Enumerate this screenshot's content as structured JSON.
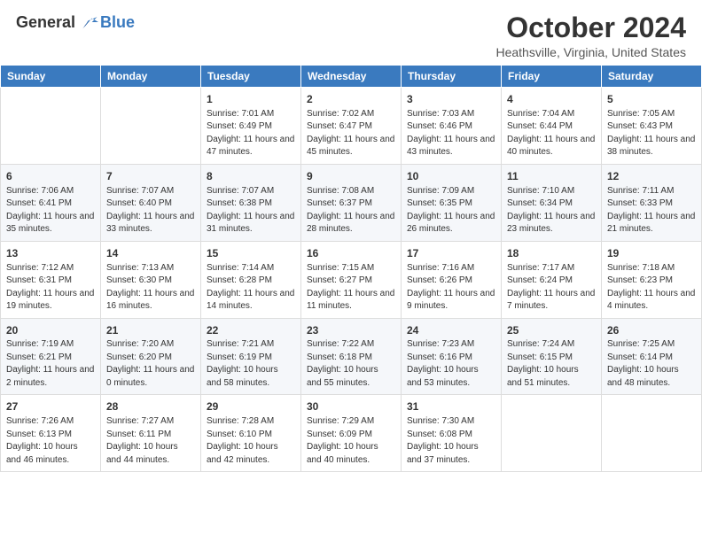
{
  "header": {
    "logo_general": "General",
    "logo_blue": "Blue",
    "title": "October 2024",
    "location": "Heathsville, Virginia, United States"
  },
  "days_of_week": [
    "Sunday",
    "Monday",
    "Tuesday",
    "Wednesday",
    "Thursday",
    "Friday",
    "Saturday"
  ],
  "weeks": [
    [
      {
        "day": "",
        "sunrise": "",
        "sunset": "",
        "daylight": ""
      },
      {
        "day": "",
        "sunrise": "",
        "sunset": "",
        "daylight": ""
      },
      {
        "day": "1",
        "sunrise": "Sunrise: 7:01 AM",
        "sunset": "Sunset: 6:49 PM",
        "daylight": "Daylight: 11 hours and 47 minutes."
      },
      {
        "day": "2",
        "sunrise": "Sunrise: 7:02 AM",
        "sunset": "Sunset: 6:47 PM",
        "daylight": "Daylight: 11 hours and 45 minutes."
      },
      {
        "day": "3",
        "sunrise": "Sunrise: 7:03 AM",
        "sunset": "Sunset: 6:46 PM",
        "daylight": "Daylight: 11 hours and 43 minutes."
      },
      {
        "day": "4",
        "sunrise": "Sunrise: 7:04 AM",
        "sunset": "Sunset: 6:44 PM",
        "daylight": "Daylight: 11 hours and 40 minutes."
      },
      {
        "day": "5",
        "sunrise": "Sunrise: 7:05 AM",
        "sunset": "Sunset: 6:43 PM",
        "daylight": "Daylight: 11 hours and 38 minutes."
      }
    ],
    [
      {
        "day": "6",
        "sunrise": "Sunrise: 7:06 AM",
        "sunset": "Sunset: 6:41 PM",
        "daylight": "Daylight: 11 hours and 35 minutes."
      },
      {
        "day": "7",
        "sunrise": "Sunrise: 7:07 AM",
        "sunset": "Sunset: 6:40 PM",
        "daylight": "Daylight: 11 hours and 33 minutes."
      },
      {
        "day": "8",
        "sunrise": "Sunrise: 7:07 AM",
        "sunset": "Sunset: 6:38 PM",
        "daylight": "Daylight: 11 hours and 31 minutes."
      },
      {
        "day": "9",
        "sunrise": "Sunrise: 7:08 AM",
        "sunset": "Sunset: 6:37 PM",
        "daylight": "Daylight: 11 hours and 28 minutes."
      },
      {
        "day": "10",
        "sunrise": "Sunrise: 7:09 AM",
        "sunset": "Sunset: 6:35 PM",
        "daylight": "Daylight: 11 hours and 26 minutes."
      },
      {
        "day": "11",
        "sunrise": "Sunrise: 7:10 AM",
        "sunset": "Sunset: 6:34 PM",
        "daylight": "Daylight: 11 hours and 23 minutes."
      },
      {
        "day": "12",
        "sunrise": "Sunrise: 7:11 AM",
        "sunset": "Sunset: 6:33 PM",
        "daylight": "Daylight: 11 hours and 21 minutes."
      }
    ],
    [
      {
        "day": "13",
        "sunrise": "Sunrise: 7:12 AM",
        "sunset": "Sunset: 6:31 PM",
        "daylight": "Daylight: 11 hours and 19 minutes."
      },
      {
        "day": "14",
        "sunrise": "Sunrise: 7:13 AM",
        "sunset": "Sunset: 6:30 PM",
        "daylight": "Daylight: 11 hours and 16 minutes."
      },
      {
        "day": "15",
        "sunrise": "Sunrise: 7:14 AM",
        "sunset": "Sunset: 6:28 PM",
        "daylight": "Daylight: 11 hours and 14 minutes."
      },
      {
        "day": "16",
        "sunrise": "Sunrise: 7:15 AM",
        "sunset": "Sunset: 6:27 PM",
        "daylight": "Daylight: 11 hours and 11 minutes."
      },
      {
        "day": "17",
        "sunrise": "Sunrise: 7:16 AM",
        "sunset": "Sunset: 6:26 PM",
        "daylight": "Daylight: 11 hours and 9 minutes."
      },
      {
        "day": "18",
        "sunrise": "Sunrise: 7:17 AM",
        "sunset": "Sunset: 6:24 PM",
        "daylight": "Daylight: 11 hours and 7 minutes."
      },
      {
        "day": "19",
        "sunrise": "Sunrise: 7:18 AM",
        "sunset": "Sunset: 6:23 PM",
        "daylight": "Daylight: 11 hours and 4 minutes."
      }
    ],
    [
      {
        "day": "20",
        "sunrise": "Sunrise: 7:19 AM",
        "sunset": "Sunset: 6:21 PM",
        "daylight": "Daylight: 11 hours and 2 minutes."
      },
      {
        "day": "21",
        "sunrise": "Sunrise: 7:20 AM",
        "sunset": "Sunset: 6:20 PM",
        "daylight": "Daylight: 11 hours and 0 minutes."
      },
      {
        "day": "22",
        "sunrise": "Sunrise: 7:21 AM",
        "sunset": "Sunset: 6:19 PM",
        "daylight": "Daylight: 10 hours and 58 minutes."
      },
      {
        "day": "23",
        "sunrise": "Sunrise: 7:22 AM",
        "sunset": "Sunset: 6:18 PM",
        "daylight": "Daylight: 10 hours and 55 minutes."
      },
      {
        "day": "24",
        "sunrise": "Sunrise: 7:23 AM",
        "sunset": "Sunset: 6:16 PM",
        "daylight": "Daylight: 10 hours and 53 minutes."
      },
      {
        "day": "25",
        "sunrise": "Sunrise: 7:24 AM",
        "sunset": "Sunset: 6:15 PM",
        "daylight": "Daylight: 10 hours and 51 minutes."
      },
      {
        "day": "26",
        "sunrise": "Sunrise: 7:25 AM",
        "sunset": "Sunset: 6:14 PM",
        "daylight": "Daylight: 10 hours and 48 minutes."
      }
    ],
    [
      {
        "day": "27",
        "sunrise": "Sunrise: 7:26 AM",
        "sunset": "Sunset: 6:13 PM",
        "daylight": "Daylight: 10 hours and 46 minutes."
      },
      {
        "day": "28",
        "sunrise": "Sunrise: 7:27 AM",
        "sunset": "Sunset: 6:11 PM",
        "daylight": "Daylight: 10 hours and 44 minutes."
      },
      {
        "day": "29",
        "sunrise": "Sunrise: 7:28 AM",
        "sunset": "Sunset: 6:10 PM",
        "daylight": "Daylight: 10 hours and 42 minutes."
      },
      {
        "day": "30",
        "sunrise": "Sunrise: 7:29 AM",
        "sunset": "Sunset: 6:09 PM",
        "daylight": "Daylight: 10 hours and 40 minutes."
      },
      {
        "day": "31",
        "sunrise": "Sunrise: 7:30 AM",
        "sunset": "Sunset: 6:08 PM",
        "daylight": "Daylight: 10 hours and 37 minutes."
      },
      {
        "day": "",
        "sunrise": "",
        "sunset": "",
        "daylight": ""
      },
      {
        "day": "",
        "sunrise": "",
        "sunset": "",
        "daylight": ""
      }
    ]
  ]
}
